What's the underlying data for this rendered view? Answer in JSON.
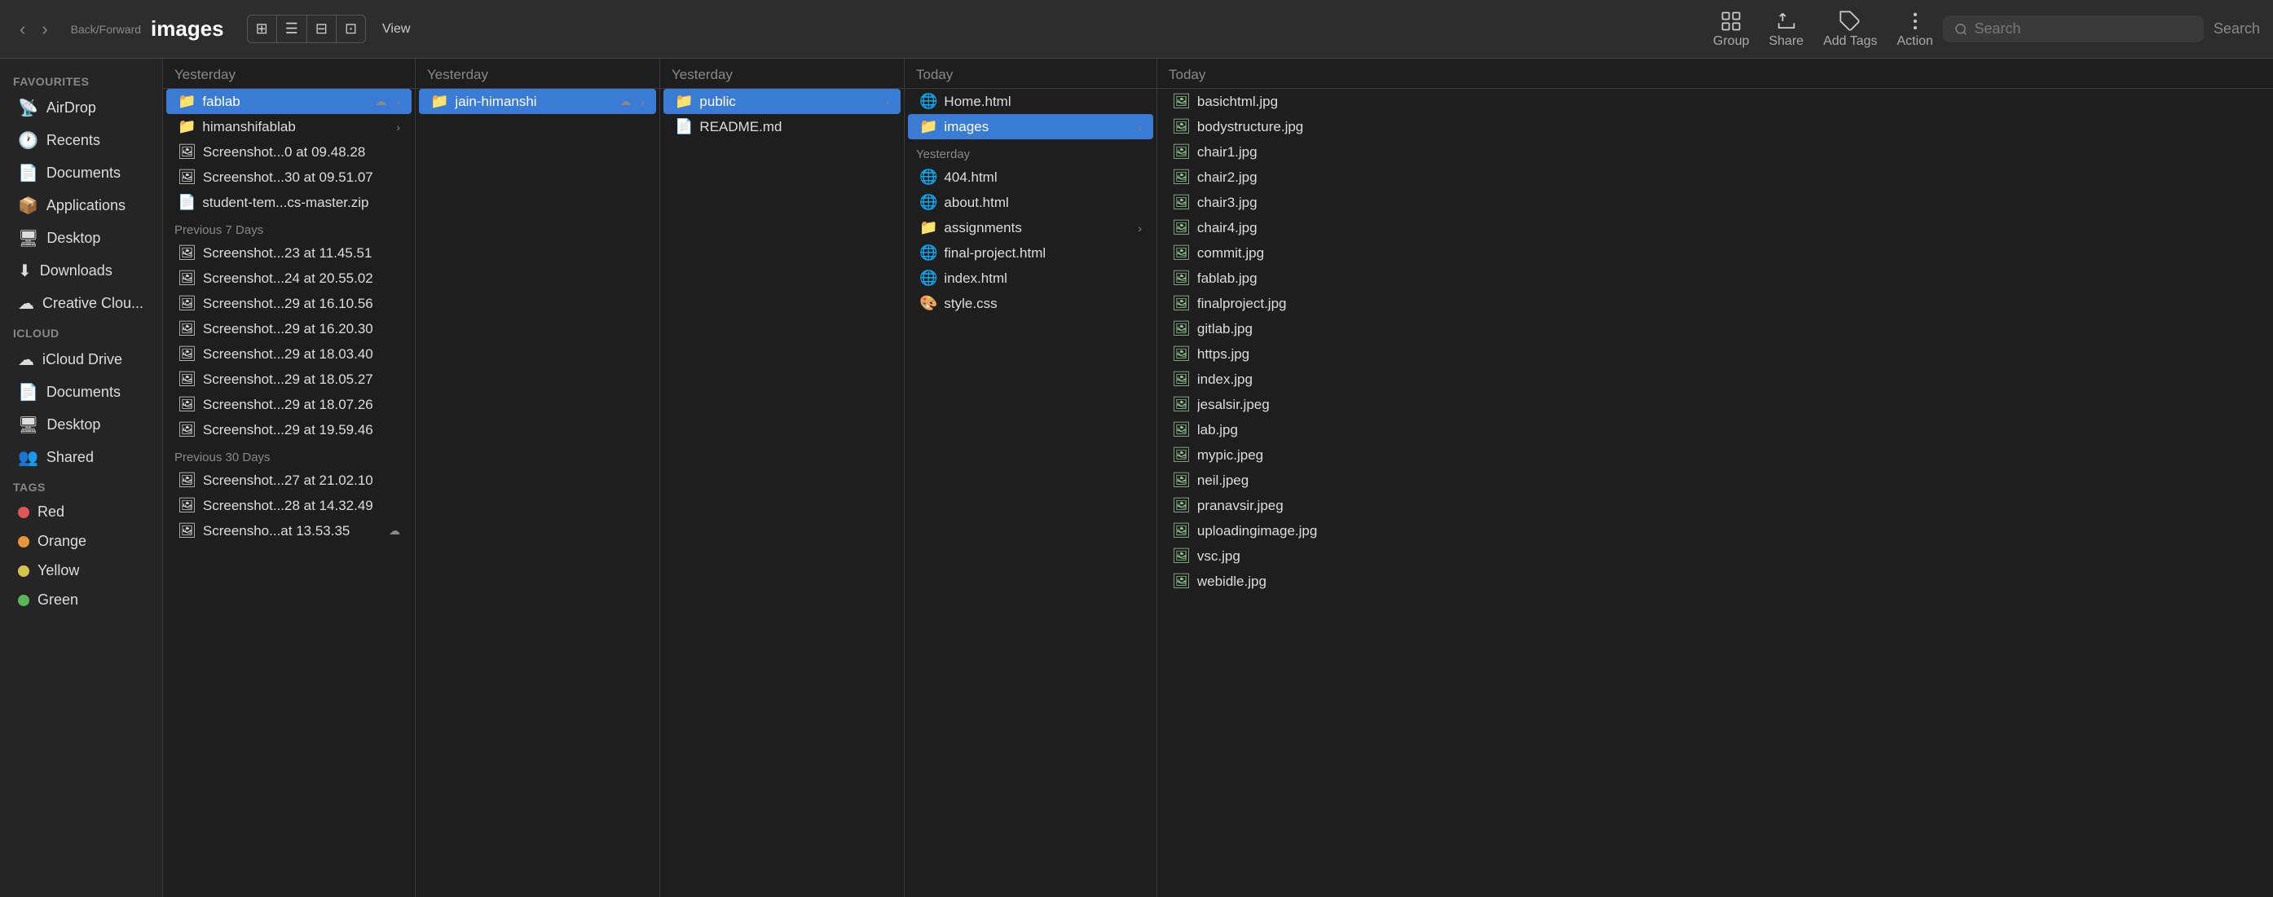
{
  "toolbar": {
    "title": "images",
    "back_label": "‹",
    "forward_label": "›",
    "back_forward_label": "Back/Forward",
    "view_label": "View",
    "group_label": "Group",
    "share_label": "Share",
    "add_tags_label": "Add Tags",
    "action_label": "Action",
    "search_placeholder": "Search",
    "search_label": "Search"
  },
  "sidebar": {
    "favourites_label": "Favourites",
    "items": [
      {
        "id": "airdrop",
        "label": "AirDrop",
        "icon": "📡"
      },
      {
        "id": "recents",
        "label": "Recents",
        "icon": "🕐"
      },
      {
        "id": "documents",
        "label": "Documents",
        "icon": "📄"
      },
      {
        "id": "applications",
        "label": "Applications",
        "icon": "📦"
      },
      {
        "id": "desktop",
        "label": "Desktop",
        "icon": "🖥"
      },
      {
        "id": "downloads",
        "label": "Downloads",
        "icon": "⬇"
      },
      {
        "id": "creative-cloud",
        "label": "Creative Clou...",
        "icon": "☁"
      }
    ],
    "icloud_label": "iCloud",
    "icloud_items": [
      {
        "id": "icloud-drive",
        "label": "iCloud Drive",
        "icon": "☁"
      },
      {
        "id": "icloud-documents",
        "label": "Documents",
        "icon": "📄"
      },
      {
        "id": "icloud-desktop",
        "label": "Desktop",
        "icon": "🖥"
      },
      {
        "id": "icloud-shared",
        "label": "Shared",
        "icon": "👥"
      }
    ],
    "tags_label": "Tags",
    "tag_items": [
      {
        "id": "red",
        "label": "Red",
        "color": "#e05555"
      },
      {
        "id": "orange",
        "label": "Orange",
        "color": "#e8943a"
      },
      {
        "id": "yellow",
        "label": "Yellow",
        "color": "#d4c44a"
      },
      {
        "id": "green",
        "label": "Green",
        "color": "#5ab55a"
      }
    ]
  },
  "columns": [
    {
      "id": "col1",
      "header": "Yesterday",
      "sections": [
        {
          "label": "",
          "items": [
            {
              "name": "fablab",
              "type": "folder",
              "selected": true,
              "cloud": true,
              "arrow": true
            },
            {
              "name": "himanshifablab",
              "type": "folder",
              "arrow": true
            },
            {
              "name": "Screenshot...0 at 09.48.28",
              "type": "screenshot"
            },
            {
              "name": "Screenshot...30 at 09.51.07",
              "type": "screenshot"
            },
            {
              "name": "student-tem...cs-master.zip",
              "type": "zip"
            }
          ]
        },
        {
          "label": "Previous 7 Days",
          "items": [
            {
              "name": "Screenshot...23 at 11.45.51",
              "type": "screenshot"
            },
            {
              "name": "Screenshot...24 at 20.55.02",
              "type": "screenshot"
            },
            {
              "name": "Screenshot...29 at 16.10.56",
              "type": "screenshot"
            },
            {
              "name": "Screenshot...29 at 16.20.30",
              "type": "screenshot"
            },
            {
              "name": "Screenshot...29 at 18.03.40",
              "type": "screenshot"
            },
            {
              "name": "Screenshot...29 at 18.05.27",
              "type": "screenshot"
            },
            {
              "name": "Screenshot...29 at 18.07.26",
              "type": "screenshot"
            },
            {
              "name": "Screenshot...29 at 19.59.46",
              "type": "screenshot"
            }
          ]
        },
        {
          "label": "Previous 30 Days",
          "items": [
            {
              "name": "Screenshot...27 at 21.02.10",
              "type": "screenshot"
            },
            {
              "name": "Screenshot...28 at 14.32.49",
              "type": "screenshot"
            },
            {
              "name": "Screensho...at 13.53.35",
              "type": "screenshot",
              "cloud": true
            }
          ]
        }
      ]
    },
    {
      "id": "col2",
      "header": "Yesterday",
      "sections": [
        {
          "label": "",
          "items": [
            {
              "name": "jain-himanshi",
              "type": "folder",
              "selected": true,
              "cloud": true,
              "arrow": true
            }
          ]
        }
      ]
    },
    {
      "id": "col3",
      "header": "Yesterday",
      "sections": [
        {
          "label": "",
          "items": [
            {
              "name": "public",
              "type": "folder",
              "selected": true,
              "arrow": true
            },
            {
              "name": "README.md",
              "type": "file"
            }
          ]
        }
      ]
    },
    {
      "id": "col4",
      "header": "Today",
      "sections": [
        {
          "label": "",
          "items": [
            {
              "name": "Home.html",
              "type": "html"
            },
            {
              "name": "images",
              "type": "folder",
              "selected": true,
              "arrow": true
            }
          ]
        },
        {
          "label": "Yesterday",
          "items": [
            {
              "name": "404.html",
              "type": "html"
            },
            {
              "name": "about.html",
              "type": "html"
            },
            {
              "name": "assignments",
              "type": "folder",
              "arrow": true
            },
            {
              "name": "final-project.html",
              "type": "html"
            },
            {
              "name": "index.html",
              "type": "html"
            },
            {
              "name": "style.css",
              "type": "css"
            }
          ]
        }
      ]
    },
    {
      "id": "col5",
      "header": "Today",
      "sections": [
        {
          "label": "",
          "items": [
            {
              "name": "basichtml.jpg",
              "type": "jpg"
            },
            {
              "name": "bodystructure.jpg",
              "type": "jpg"
            },
            {
              "name": "chair1.jpg",
              "type": "jpg"
            },
            {
              "name": "chair2.jpg",
              "type": "jpg"
            },
            {
              "name": "chair3.jpg",
              "type": "jpg"
            },
            {
              "name": "chair4.jpg",
              "type": "jpg"
            },
            {
              "name": "commit.jpg",
              "type": "jpg"
            },
            {
              "name": "fablab.jpg",
              "type": "jpg"
            },
            {
              "name": "finalproject.jpg",
              "type": "jpg"
            },
            {
              "name": "gitlab.jpg",
              "type": "jpg"
            },
            {
              "name": "https.jpg",
              "type": "jpg"
            },
            {
              "name": "index.jpg",
              "type": "jpg"
            },
            {
              "name": "jesalsir.jpeg",
              "type": "jpeg"
            },
            {
              "name": "lab.jpg",
              "type": "jpg"
            },
            {
              "name": "mypic.jpeg",
              "type": "jpeg"
            },
            {
              "name": "neil.jpeg",
              "type": "jpeg"
            },
            {
              "name": "pranavsir.jpeg",
              "type": "jpeg"
            },
            {
              "name": "uploadingimage.jpg",
              "type": "jpg"
            },
            {
              "name": "vsc.jpg",
              "type": "jpg"
            },
            {
              "name": "webidle.jpg",
              "type": "jpg"
            }
          ]
        }
      ]
    }
  ]
}
